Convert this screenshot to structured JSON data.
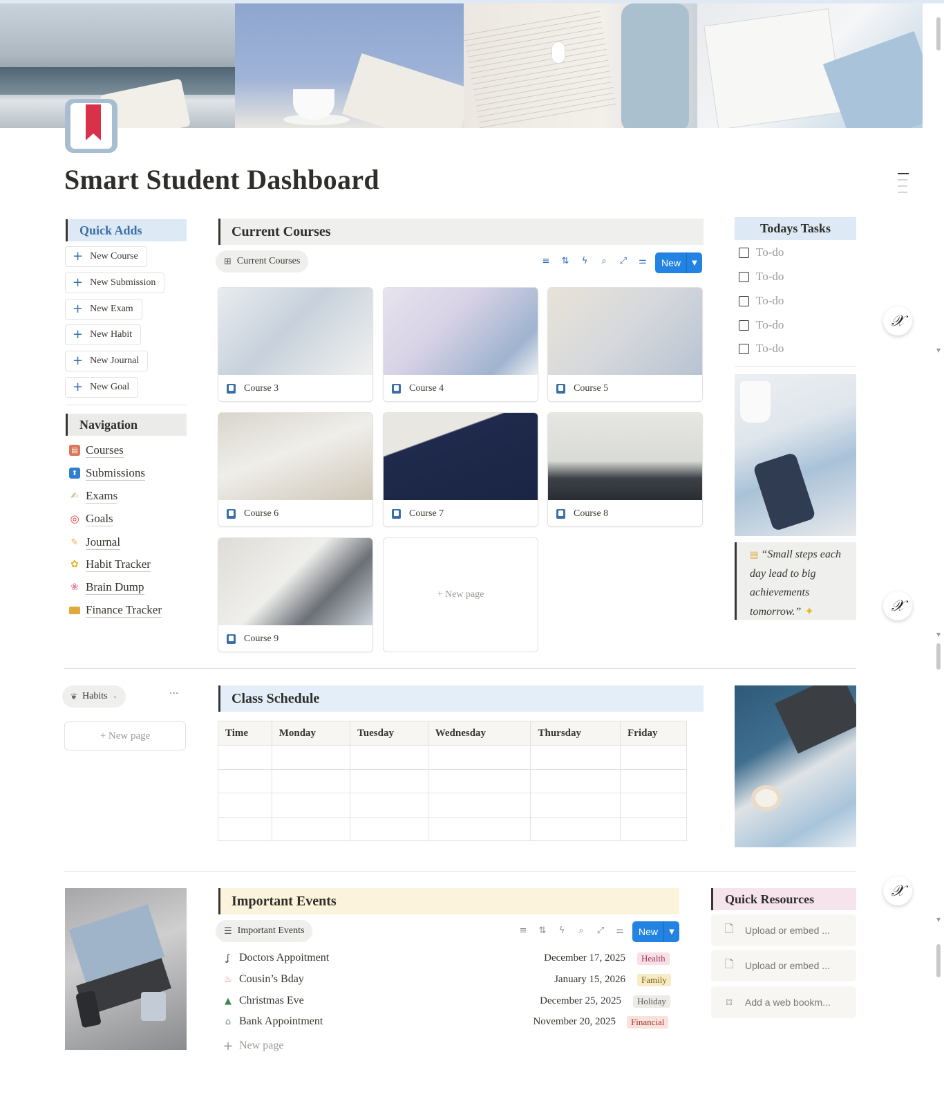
{
  "page": {
    "title": "Smart Student Dashboard"
  },
  "quick_adds": {
    "heading": "Quick Adds",
    "buttons": [
      "New Course",
      "New Submission",
      "New Exam",
      "New Habit",
      "New Journal",
      "New Goal"
    ]
  },
  "navigation": {
    "heading": "Navigation",
    "items": [
      {
        "label": "Courses",
        "icon": "notebook-icon",
        "color": "#d9775a"
      },
      {
        "label": "Submissions",
        "icon": "upload-arrow-icon",
        "color": "#2f7fd0"
      },
      {
        "label": "Exams",
        "icon": "writing-hand-icon",
        "color": "#c9a06b"
      },
      {
        "label": "Goals",
        "icon": "target-icon",
        "color": "#e03e3e"
      },
      {
        "label": "Journal",
        "icon": "memo-icon",
        "color": "#e8b04a"
      },
      {
        "label": "Habit Tracker",
        "icon": "sunflower-icon",
        "color": "#e6b422"
      },
      {
        "label": "Brain Dump",
        "icon": "brain-icon",
        "color": "#e9899b"
      },
      {
        "label": "Finance Tracker",
        "icon": "credit-card-icon",
        "color": "#e0a93a"
      }
    ]
  },
  "current_courses": {
    "heading": "Current Courses",
    "view_label": "Current Courses",
    "new_label": "New",
    "cards": [
      "Course 3",
      "Course 4",
      "Course 5",
      "Course 6",
      "Course 7",
      "Course 8",
      "Course 9"
    ],
    "new_page_label": "+ New page"
  },
  "todays_tasks": {
    "heading": "Todays Tasks",
    "items": [
      "To-do",
      "To-do",
      "To-do",
      "To-do",
      "To-do"
    ]
  },
  "quote": {
    "text": "“Small steps each day lead to big achievements tomorrow.”"
  },
  "habits": {
    "view_label": "Habits",
    "new_page_label": "+ New page"
  },
  "class_schedule": {
    "heading": "Class Schedule",
    "columns": [
      "Time",
      "Monday",
      "Tuesday",
      "Wednesday",
      "Thursday",
      "Friday"
    ]
  },
  "important_events": {
    "heading": "Important Events",
    "view_label": "Important Events",
    "new_label": "New",
    "new_page_label": "New page",
    "events": [
      {
        "name": "Doctors Appoitment",
        "date": "December 17, 2025",
        "tag": "Health",
        "tag_bg": "#f9dfe6",
        "tag_fg": "#9b3b57",
        "icon": "stethoscope-icon"
      },
      {
        "name": "Cousin’s Bday",
        "date": "January 15, 2026",
        "tag": "Family",
        "tag_bg": "#f7ecc6",
        "tag_fg": "#7a5c12",
        "icon": "cake-icon"
      },
      {
        "name": "Christmas Eve",
        "date": "December 25, 2025",
        "tag": "Holiday",
        "tag_bg": "#ecebe8",
        "tag_fg": "#5a5955",
        "icon": "tree-icon"
      },
      {
        "name": "Bank Appointment",
        "date": "November 20, 2025",
        "tag": "Financial",
        "tag_bg": "#fbe1dc",
        "tag_fg": "#9b3b2b",
        "icon": "bank-icon"
      }
    ]
  },
  "quick_resources": {
    "heading": "Quick Resources",
    "items": [
      {
        "label": "Upload or embed ...",
        "icon": "file-upload-icon"
      },
      {
        "label": "Upload or embed ...",
        "icon": "file-upload-icon"
      },
      {
        "label": "Add a web bookm...",
        "icon": "bookmark-icon"
      }
    ]
  },
  "colors": {
    "accent": "#2383e2",
    "link_blue": "#3b6fa8"
  }
}
